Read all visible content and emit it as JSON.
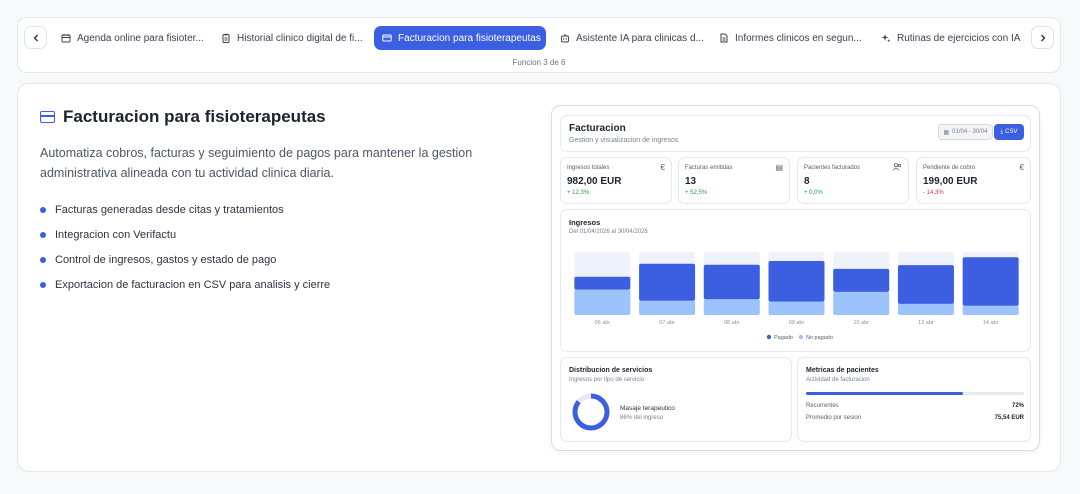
{
  "colors": {
    "accent": "#3b5fe0",
    "paid": "#3b5fe0",
    "unpaid": "#9cc3fb",
    "positive": "#1f9d55",
    "negative": "#e0305a"
  },
  "tabs": {
    "prev_icon": "chevron-left-icon",
    "next_icon": "chevron-right-icon",
    "items": [
      {
        "label": "Agenda online para fisioter...",
        "icon": "calendar-icon"
      },
      {
        "label": "Historial clinico digital de fi...",
        "icon": "clipboard-icon"
      },
      {
        "label": "Facturacion para fisioterapeutas",
        "icon": "credit-card-icon",
        "active": true
      },
      {
        "label": "Asistente IA para clinicas d...",
        "icon": "bot-icon"
      },
      {
        "label": "Informes clinicos en segun...",
        "icon": "document-icon"
      },
      {
        "label": "Rutinas de ejercicios con IA",
        "icon": "sparkles-icon"
      }
    ],
    "counter": "Funcion 3 de 6"
  },
  "feature": {
    "title": "Facturacion para fisioterapeutas",
    "description": "Automatiza cobros, facturas y seguimiento de pagos para mantener la gestion administrativa alineada con tu actividad clinica diaria.",
    "bullets": [
      "Facturas generadas desde citas y tratamientos",
      "Integracion con Verifactu",
      "Control de ingresos, gastos y estado de pago",
      "Exportacion de facturacion en CSV para analisis y cierre"
    ]
  },
  "preview": {
    "header": {
      "title": "Facturacion",
      "subtitle": "Gestion y visualizacion de ingresos",
      "date_range": "01/04 - 30/04",
      "csv_label": "CSV"
    },
    "stats": [
      {
        "label": "Ingresos totales",
        "value": "982,00 EUR",
        "change": "+ 12,3%",
        "trend": "up",
        "icon": "€"
      },
      {
        "label": "Facturas emitidas",
        "value": "13",
        "change": "+ 52,5%",
        "trend": "up",
        "icon": "▤"
      },
      {
        "label": "Pacientes facturados",
        "value": "8",
        "change": "+ 0,0%",
        "trend": "up",
        "icon": "👥"
      },
      {
        "label": "Pendiente de cobro",
        "value": "199,00 EUR",
        "change": "- 14,3%",
        "trend": "down",
        "icon": "€"
      }
    ],
    "distribution": {
      "title": "Distribucion de servicios",
      "subtitle": "Ingresos por tipo de servicio",
      "item_name": "Masaje terapeutico",
      "item_pct_label": "86% del ingreso",
      "fraction": 0.86
    },
    "metrics": {
      "title": "Metricas de pacientes",
      "subtitle": "Actividad de facturacion",
      "bar_fraction": 0.72,
      "rows": [
        {
          "label": "Recurrentes",
          "value": "72%"
        },
        {
          "label": "Promedio por sesion",
          "value": "75,54 EUR"
        }
      ]
    }
  },
  "chart_data": {
    "type": "bar",
    "title": "Ingresos",
    "subtitle": "Del 01/04/2026 al 30/04/2026",
    "categories": [
      "06 abr",
      "07 abr",
      "08 abr",
      "09 abr",
      "10 abr",
      "13 abr",
      "14 abr"
    ],
    "stacked": true,
    "series": [
      {
        "name": "Pagado",
        "values": [
          28,
          80,
          75,
          88,
          50,
          84,
          105
        ]
      },
      {
        "name": "No pagado",
        "values": [
          55,
          31,
          34,
          29,
          50,
          24,
          20
        ]
      }
    ],
    "ylim": [
      0,
      130
    ],
    "grid": false,
    "legend_position": "bottom-center"
  }
}
